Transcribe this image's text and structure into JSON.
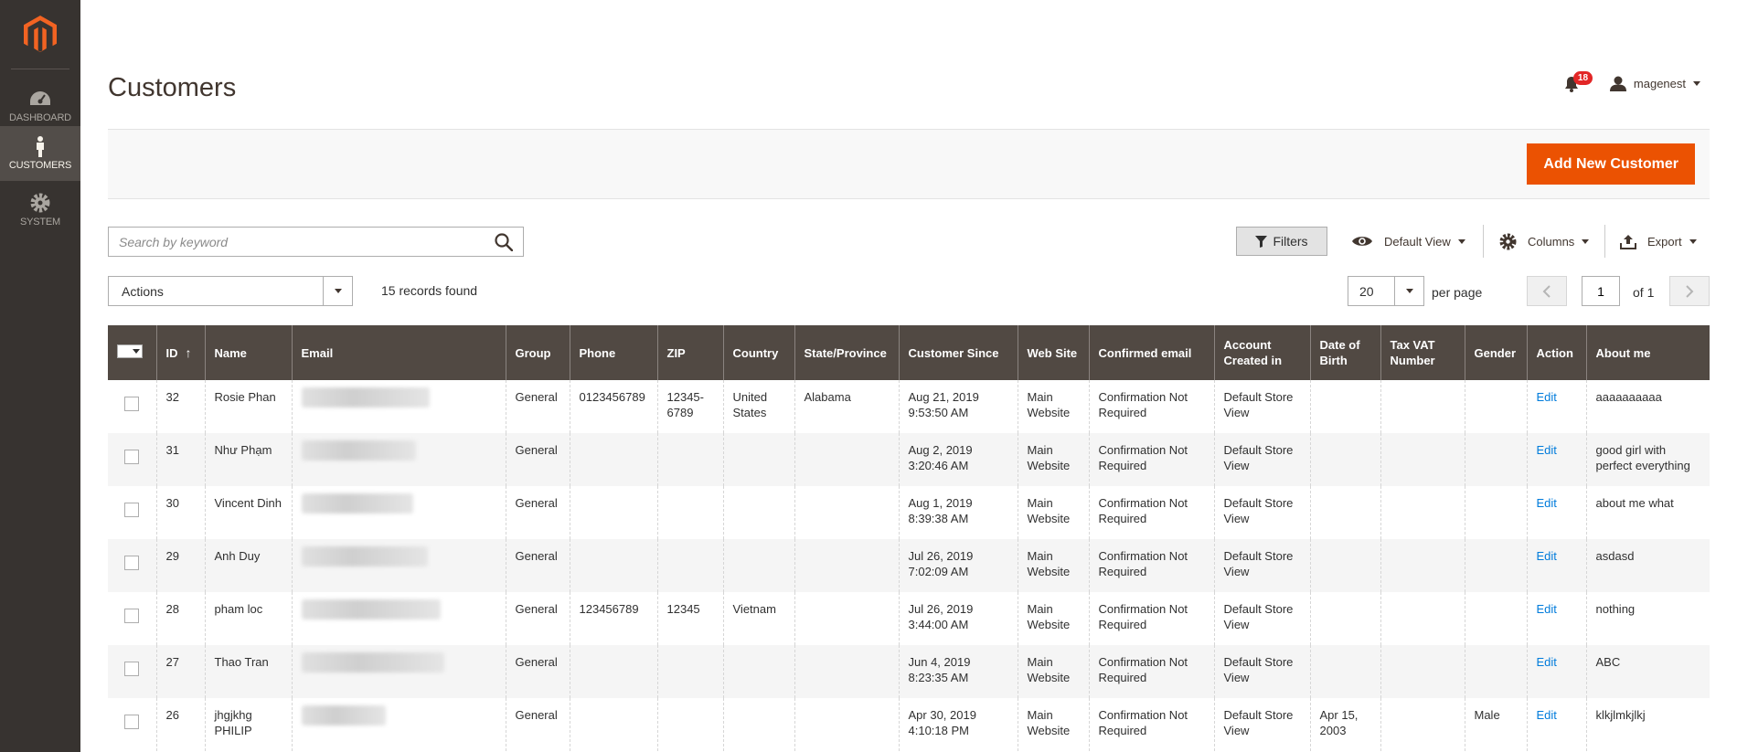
{
  "sidebar": {
    "items": [
      {
        "label": "DASHBOARD",
        "icon": "dashboard-icon"
      },
      {
        "label": "CUSTOMERS",
        "icon": "customers-icon"
      },
      {
        "label": "SYSTEM",
        "icon": "system-gear-icon"
      }
    ]
  },
  "header": {
    "title": "Customers",
    "notifications_count": "18",
    "username": "magenest"
  },
  "actions_bar": {
    "add_button": "Add New Customer"
  },
  "toolbar": {
    "search_placeholder": "Search by keyword",
    "filters_label": "Filters",
    "view_label": "Default View",
    "columns_label": "Columns",
    "export_label": "Export",
    "actions_label": "Actions",
    "records_found": "15 records found",
    "per_page_value": "20",
    "per_page_label": "per page",
    "current_page": "1",
    "page_total": "of 1"
  },
  "grid": {
    "columns": [
      "ID",
      "Name",
      "Email",
      "Group",
      "Phone",
      "ZIP",
      "Country",
      "State/Province",
      "Customer Since",
      "Web Site",
      "Confirmed email",
      "Account Created in",
      "Date of Birth",
      "Tax VAT Number",
      "Gender",
      "Action",
      "About me"
    ],
    "sort_indicator": "↑",
    "rows": [
      {
        "id": "32",
        "name": "Rosie Phan",
        "group": "General",
        "phone": "0123456789",
        "zip": "12345-6789",
        "country": "United States",
        "state": "Alabama",
        "since": "Aug 21, 2019 9:53:50 AM",
        "website": "Main Website",
        "confirmed": "Confirmation Not Required",
        "created_in": "Default Store View",
        "dob": "",
        "taxvat": "",
        "gender": "",
        "action": "Edit",
        "about": "aaaaaaaaaa"
      },
      {
        "id": "31",
        "name": "Như Phạm",
        "group": "General",
        "phone": "",
        "zip": "",
        "country": "",
        "state": "",
        "since": "Aug 2, 2019 3:20:46 AM",
        "website": "Main Website",
        "confirmed": "Confirmation Not Required",
        "created_in": "Default Store View",
        "dob": "",
        "taxvat": "",
        "gender": "",
        "action": "Edit",
        "about": "good girl with perfect everything"
      },
      {
        "id": "30",
        "name": "Vincent Dinh",
        "group": "General",
        "phone": "",
        "zip": "",
        "country": "",
        "state": "",
        "since": "Aug 1, 2019 8:39:38 AM",
        "website": "Main Website",
        "confirmed": "Confirmation Not Required",
        "created_in": "Default Store View",
        "dob": "",
        "taxvat": "",
        "gender": "",
        "action": "Edit",
        "about": "about me what"
      },
      {
        "id": "29",
        "name": "Anh Duy",
        "group": "General",
        "phone": "",
        "zip": "",
        "country": "",
        "state": "",
        "since": "Jul 26, 2019 7:02:09 AM",
        "website": "Main Website",
        "confirmed": "Confirmation Not Required",
        "created_in": "Default Store View",
        "dob": "",
        "taxvat": "",
        "gender": "",
        "action": "Edit",
        "about": "asdasd"
      },
      {
        "id": "28",
        "name": "pham loc",
        "group": "General",
        "phone": "123456789",
        "zip": "12345",
        "country": "Vietnam",
        "state": "",
        "since": "Jul 26, 2019 3:44:00 AM",
        "website": "Main Website",
        "confirmed": "Confirmation Not Required",
        "created_in": "Default Store View",
        "dob": "",
        "taxvat": "",
        "gender": "",
        "action": "Edit",
        "about": "nothing"
      },
      {
        "id": "27",
        "name": "Thao Tran",
        "group": "General",
        "phone": "",
        "zip": "",
        "country": "",
        "state": "",
        "since": "Jun 4, 2019 8:23:35 AM",
        "website": "Main Website",
        "confirmed": "Confirmation Not Required",
        "created_in": "Default Store View",
        "dob": "",
        "taxvat": "",
        "gender": "",
        "action": "Edit",
        "about": "ABC"
      },
      {
        "id": "26",
        "name": "jhgjkhg PHILIP",
        "group": "General",
        "phone": "",
        "zip": "",
        "country": "",
        "state": "",
        "since": "Apr 30, 2019 4:10:18 PM",
        "website": "Main Website",
        "confirmed": "Confirmation Not Required",
        "created_in": "Default Store View",
        "dob": "Apr 15, 2003",
        "taxvat": "",
        "gender": "Male",
        "action": "Edit",
        "about": "klkjlmkjlkj"
      }
    ]
  },
  "colors": {
    "sidebar_bg": "#373330",
    "accent": "#eb5202",
    "grid_header": "#514943",
    "link": "#007bdb",
    "badge": "#e22626"
  }
}
